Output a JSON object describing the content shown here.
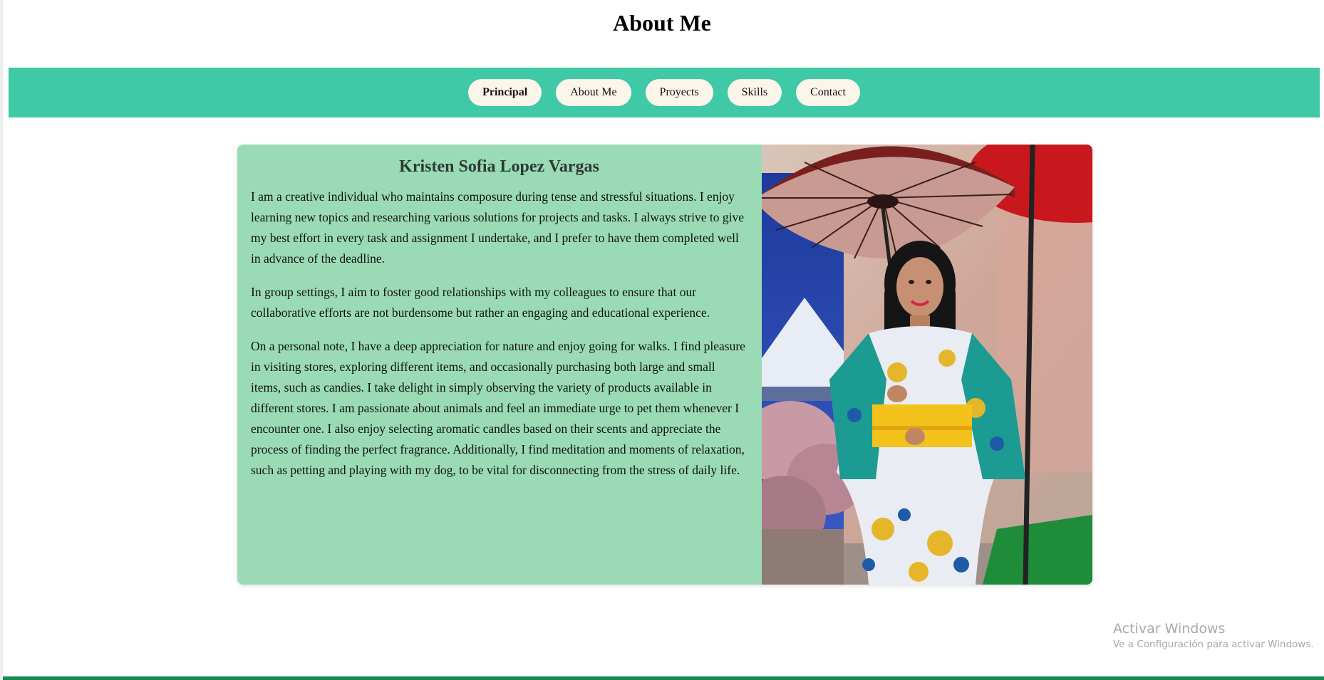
{
  "page": {
    "title": "About Me"
  },
  "nav": {
    "items": [
      {
        "label": "Principal",
        "active": true
      },
      {
        "label": "About Me",
        "active": false
      },
      {
        "label": "Proyects",
        "active": false
      },
      {
        "label": "Skills",
        "active": false
      },
      {
        "label": "Contact",
        "active": false
      }
    ]
  },
  "profile": {
    "name": "Kristen Sofia Lopez Vargas",
    "paragraphs": [
      "I am a creative individual who maintains composure during tense and stressful situations. I enjoy learning new topics and researching various solutions for projects and tasks. I always strive to give my best effort in every task and assignment I undertake, and I prefer to have them completed well in advance of the deadline.",
      "In group settings, I aim to foster good relationships with my colleagues to ensure that our collaborative efforts are not burdensome but rather an engaging and educational experience.",
      "On a personal note, I have a deep appreciation for nature and enjoy going for walks. I find pleasure in visiting stores, exploring different items, and occasionally purchasing both large and small items, such as candies. I take delight in simply observing the variety of products available in different stores. I am passionate about animals and feel an immediate urge to pet them whenever I encounter one. I also enjoy selecting aromatic candles based on their scents and appreciate the process of finding the perfect fragrance. Additionally, I find meditation and moments of relaxation, such as petting and playing with my dog, to be vital for disconnecting from the stress of daily life."
    ],
    "photo_icon": "profile-photo"
  },
  "watermark": {
    "title": "Activar Windows",
    "subtitle": "Ve a Configuración para activar Windows."
  },
  "colors": {
    "navbar": "#3fc9a6",
    "nav_button": "#fbf5ea",
    "card_text_bg": "#9adbb5",
    "bottom_bar": "#138a52"
  }
}
